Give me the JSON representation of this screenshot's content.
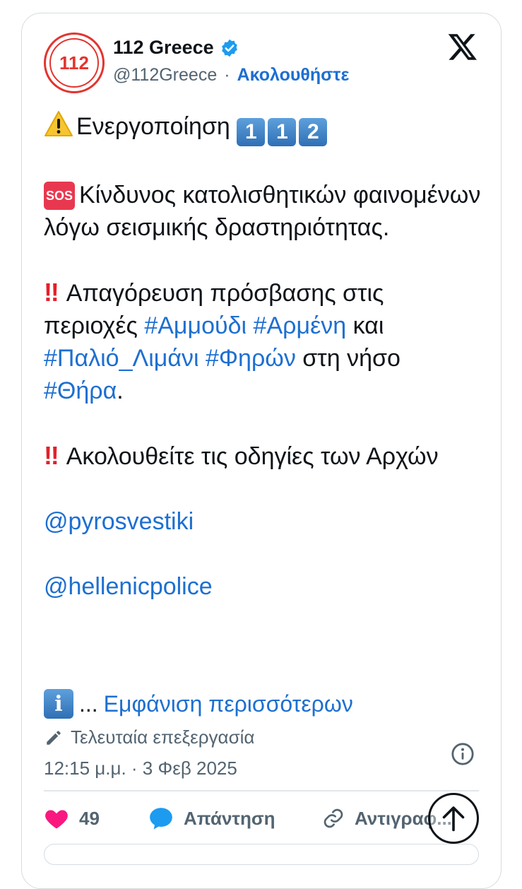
{
  "account": {
    "name": "112 Greece",
    "handle": "@112Greece",
    "separator": "·",
    "follow_label": "Ακολουθήστε",
    "avatar_text": "112"
  },
  "post": {
    "line_activation": "Ενεργοποίηση",
    "keycaps": [
      "1",
      "1",
      "2"
    ],
    "sos_label": "SOS",
    "danger_text": "Κίνδυνος κατολισθητικών φαινομένων λόγω σεισμικής δραστηριότητας.",
    "bang": "‼",
    "ban_text_1": "Απαγόρευση πρόσβασης στις περιοχές ",
    "tag_ammoudi": "#Αμμούδι",
    "tag_armeni": "#Αρμένη",
    "and": " και ",
    "tag_palio": "#Παλιό_Λιμάνι",
    "tag_firon": "#Φηρών",
    "island_text": " στη νήσο ",
    "tag_thira": "#Θήρα",
    "period": ".",
    "follow_text": "Ακολουθείτε τις οδηγίες των Αρχών",
    "mention_fire": "@pyrosvestiki",
    "mention_police": "@hellenicpolice",
    "info_glyph": "i",
    "ellipsis": "...",
    "show_more": "Εμφάνιση περισσότερων"
  },
  "meta": {
    "edited_label": "Τελευταία επεξεργασία",
    "timestamp": "12:15 μ.μ. · 3 Φεβ 2025"
  },
  "actions": {
    "like_count": "49",
    "reply_label": "Απάντηση",
    "copy_label": "Αντιγραφ..."
  },
  "colors": {
    "link": "#1d6fd1",
    "like": "#f91880",
    "verified": "#1d9bf0",
    "alert_red": "#e3202a"
  },
  "icons": [
    "verified-badge-icon",
    "x-logo-icon",
    "warning-icon",
    "edit-pencil-icon",
    "info-icon",
    "heart-icon",
    "reply-bubble-icon",
    "link-icon",
    "arrow-up-icon"
  ]
}
